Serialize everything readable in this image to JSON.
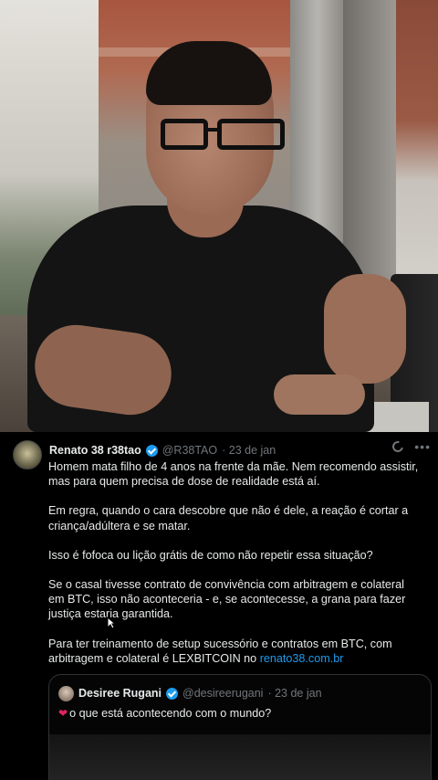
{
  "tweet": {
    "author_name": "Renato 38 r38tao",
    "author_handle": "@R38TAO",
    "date": "· 23 de jan",
    "paragraphs": [
      "Homem mata filho de 4 anos na frente da mãe. Nem recomendo assistir, mas para quem precisa de dose de realidade está aí.",
      "Em regra, quando o cara descobre que não é dele, a reação é cortar a criança/adúltera e se matar.",
      "Isso é fofoca ou lição grátis de como não repetir essa situação?",
      "Se o casal tivesse contrato de convivência com arbitragem e colateral em BTC, isso não aconteceria  - e, se acontecesse, a grana para fazer justiça estaria garantida."
    ],
    "last_paragraph_prefix": "Para ter treinamento de setup sucessório e contratos em BTC, com arbitragem e colateral é LEXBITCOIN no ",
    "link": "renato38.com.br",
    "icons": [
      "grok-icon",
      "more-icon"
    ],
    "more_glyph": "•••"
  },
  "quote": {
    "author_name": "Desiree Rugani",
    "author_handle": "@desireerugani",
    "date": "· 23 de jan",
    "text": "o que está acontecendo com o mundo?",
    "emoji": "❤"
  },
  "colors": {
    "background": "#000000",
    "text": "#e7e9ea",
    "muted": "#71767b",
    "link": "#1d9bf0",
    "verified": "#1d9bf0"
  }
}
